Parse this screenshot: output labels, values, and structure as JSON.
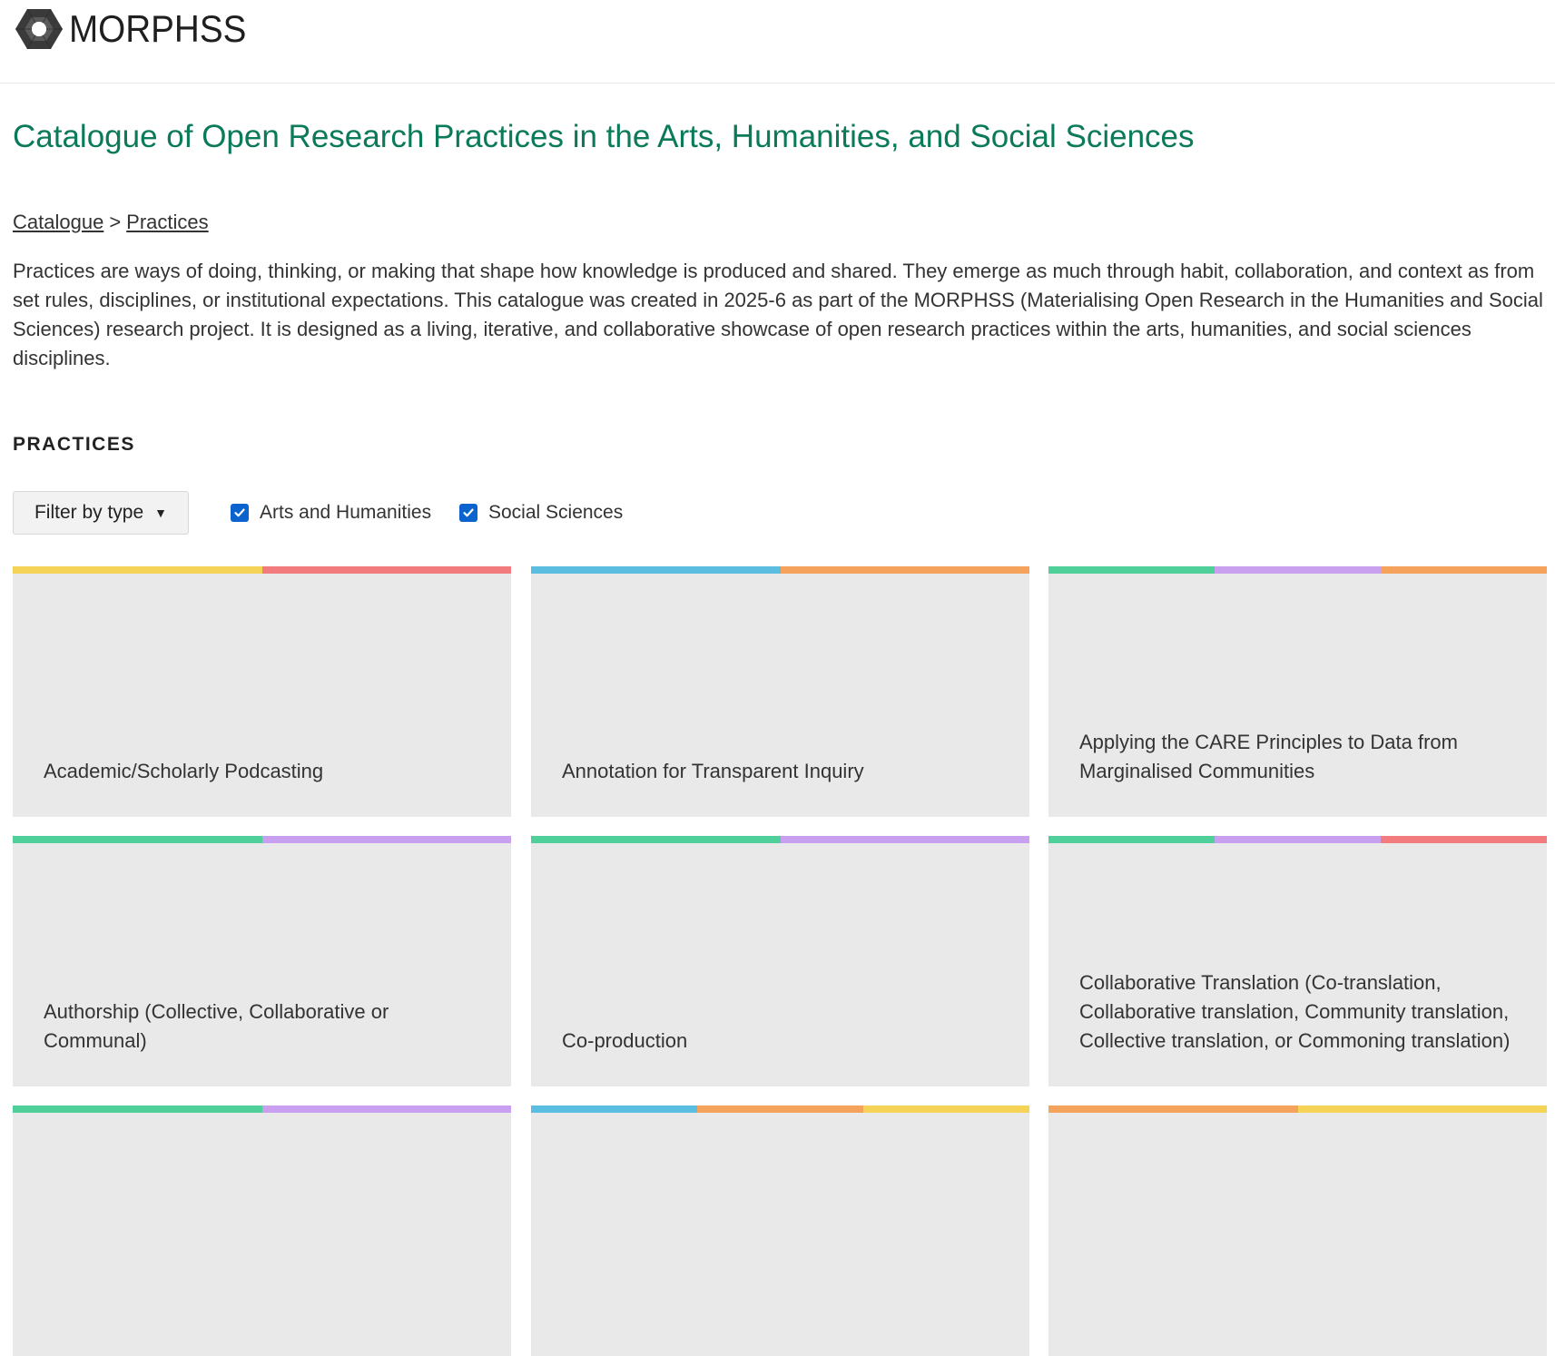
{
  "header": {
    "brand": "MORPHSS"
  },
  "page": {
    "title": "Catalogue of Open Research Practices in the Arts, Humanities, and Social Sciences",
    "intro": "Practices are ways of doing, thinking, or making that shape how knowledge is produced and shared. They emerge as much through habit, collaboration, and context as from set rules, disciplines, or institutional expectations. This catalogue was created in 2025-6 as part of the MORPHSS (Materialising Open Research in the Humanities and Social Sciences) research project. It is designed as a living, iterative, and collaborative showcase of open research practices within the arts, humanities, and social sciences disciplines."
  },
  "breadcrumb": {
    "items": [
      {
        "label": "Catalogue"
      },
      {
        "label": "Practices"
      }
    ],
    "separator": ">"
  },
  "practices": {
    "heading": "PRACTICES",
    "filter": {
      "button_label": "Filter by type",
      "options": [
        {
          "label": "Arts and Humanities",
          "checked": true
        },
        {
          "label": "Social Sciences",
          "checked": true
        }
      ]
    },
    "cards": [
      {
        "title": "Academic/Scholarly Podcasting",
        "stripe_colors": [
          "#f4d356",
          "#f27b7e"
        ]
      },
      {
        "title": "Annotation for Transparent Inquiry",
        "stripe_colors": [
          "#5bbde0",
          "#f5a35c"
        ]
      },
      {
        "title": "Applying the CARE Principles to Data from Marginalised Communities",
        "stripe_colors": [
          "#4fcf9a",
          "#c8a0ef",
          "#f5a35c"
        ]
      },
      {
        "title": "Authorship (Collective, Collaborative or Communal)",
        "stripe_colors": [
          "#4fcf9a",
          "#c8a0ef"
        ]
      },
      {
        "title": "Co-production",
        "stripe_colors": [
          "#4fcf9a",
          "#c8a0ef"
        ]
      },
      {
        "title": "Collaborative Translation (Co-translation, Collaborative translation, Community translation, Collective translation, or Commoning translation)",
        "stripe_colors": [
          "#4fcf9a",
          "#c8a0ef",
          "#f27b7e"
        ]
      },
      {
        "title": "",
        "stripe_colors": [
          "#4fcf9a",
          "#c8a0ef"
        ]
      },
      {
        "title": "",
        "stripe_colors": [
          "#5bbde0",
          "#f5a35c",
          "#f4d356"
        ]
      },
      {
        "title": "",
        "stripe_colors": [
          "#f5a35c",
          "#f4d356"
        ]
      }
    ]
  },
  "colors": {
    "title_green": "#0a7a5a",
    "card_background": "#e9e9e9",
    "checkbox_blue": "#0b63ce"
  },
  "icons": {
    "logo": "hexagon-ring-icon",
    "dropdown": "caret-down-icon",
    "check": "checkmark-icon"
  }
}
